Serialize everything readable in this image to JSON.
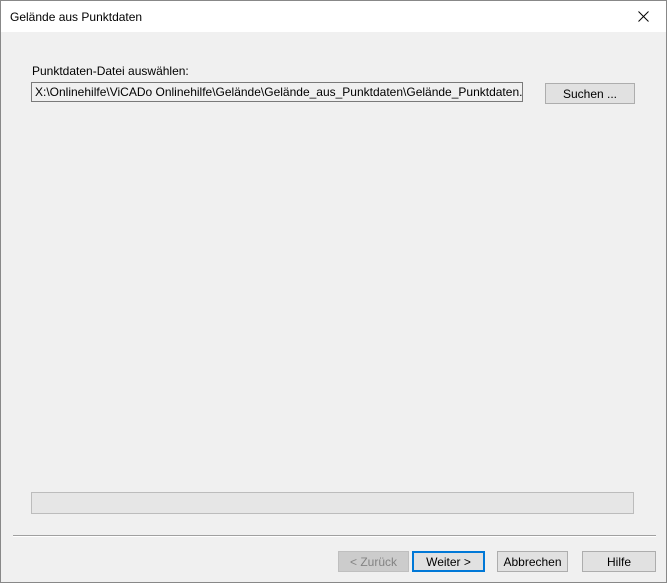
{
  "window": {
    "title": "Gelände aus Punktdaten"
  },
  "form": {
    "file_label": "Punktdaten-Datei auswählen:",
    "file_path": "X:\\Onlinehilfe\\ViCADo Onlinehilfe\\Gelände\\Gelände_aus_Punktdaten\\Gelände_Punktdaten.txt",
    "browse_label": "Suchen ..."
  },
  "progress": {
    "value": 0
  },
  "footer": {
    "back_label": "< Zurück",
    "next_label": "Weiter >",
    "cancel_label": "Abbrechen",
    "help_label": "Hilfe"
  },
  "colors": {
    "accent": "#0078d7",
    "disabled_text": "#838383"
  },
  "icons": {
    "close": "close-icon"
  }
}
